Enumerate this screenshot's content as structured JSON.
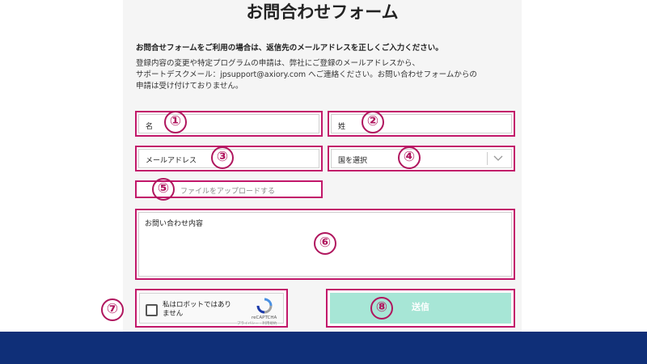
{
  "form": {
    "title": "お問合わせフォーム",
    "intro_bold": "お問合せフォームをご利用の場合は、返信先のメールアドレスを正しくご入力ください。",
    "intro_lines": [
      "登録内容の変更や特定プログラムの申請は、弊社にご登録のメールアドレスから、",
      "サポートデスクメール：jpsupport@axiory.com へご連絡ください。お問い合わせフォームからの",
      "申請は受け付けておりません。"
    ],
    "first_name_placeholder": "名",
    "last_name_placeholder": "姓",
    "email_placeholder": "メールアドレス",
    "country_placeholder": "国を選択",
    "upload_label": "ファイルをアップロードする",
    "message_placeholder": "お問い合わせ内容",
    "submit_label": "送信"
  },
  "captcha": {
    "label": "私はロボットではありません",
    "brand": "reCAPTCHA",
    "links": "プライバシー - 利用規約"
  },
  "markers": [
    "①",
    "②",
    "③",
    "④",
    "⑤",
    "⑥",
    "⑦",
    "⑧"
  ],
  "colors": {
    "highlight_border": "#c2186a",
    "marker": "#b0165e",
    "submit_bg": "#a7e6d6",
    "footer_bg": "#0f2f78",
    "panel_bg": "#f5f5f5"
  },
  "icons": {
    "country_select": "chevron-down-icon",
    "captcha_logo": "recaptcha-icon"
  }
}
